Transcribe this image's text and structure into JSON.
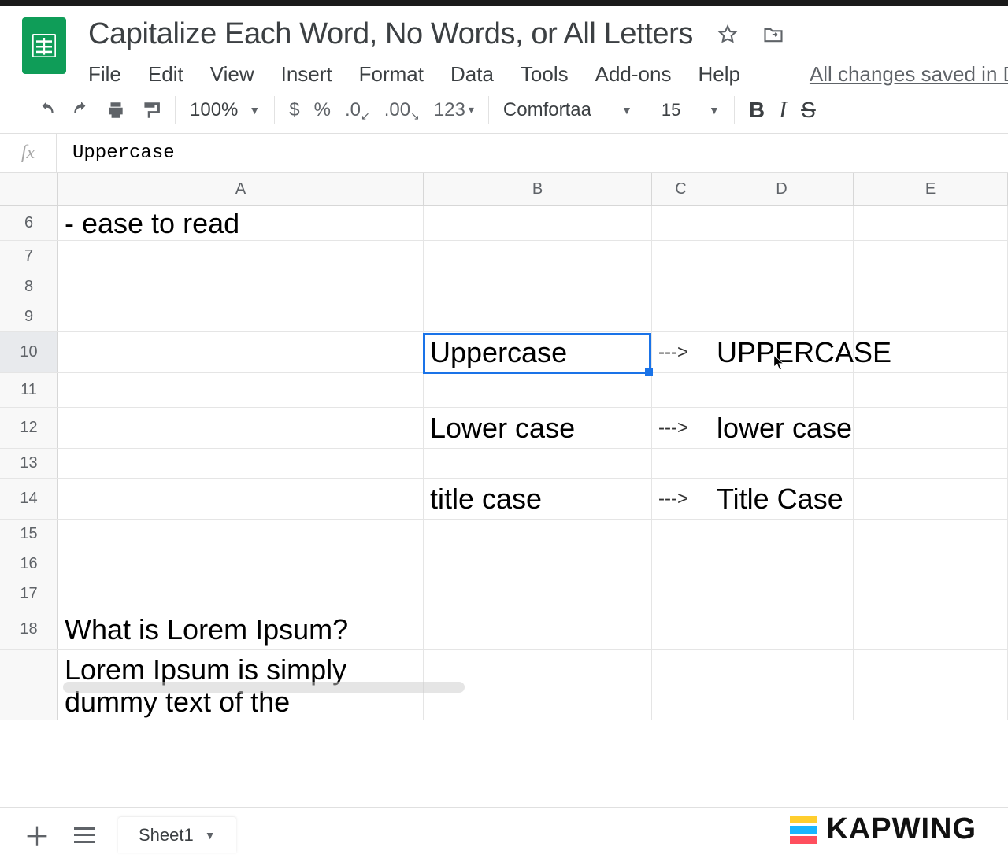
{
  "document_title": "Capitalize Each Word, No Words, or All Letters",
  "menu": {
    "file": "File",
    "edit": "Edit",
    "view": "View",
    "insert": "Insert",
    "format": "Format",
    "data": "Data",
    "tools": "Tools",
    "addons": "Add-ons",
    "help": "Help"
  },
  "save_status": "All changes saved in Dr",
  "toolbar": {
    "zoom": "100%",
    "currency": "$",
    "percent": "%",
    "dec_dec": ".0",
    "inc_dec": ".00",
    "numformat": "123",
    "font_name": "Comfortaa",
    "font_size": "15",
    "bold": "B",
    "italic": "I",
    "strike": "S"
  },
  "formula_bar": {
    "label": "fx",
    "value": "Uppercase"
  },
  "columns": {
    "A": "A",
    "B": "B",
    "C": "C",
    "D": "D",
    "E": "E"
  },
  "row_headers": [
    "6",
    "7",
    "8",
    "9",
    "10",
    "11",
    "12",
    "13",
    "14",
    "15",
    "16",
    "17",
    "18",
    ""
  ],
  "cells": {
    "A6": "- ease to read",
    "B10": "Uppercase",
    "C10": "--->",
    "D10": "UPPERCASE",
    "B12": "Lower case",
    "C12": "--->",
    "D12": "lower case",
    "B14": "title case",
    "C14": "--->",
    "D14": "Title Case",
    "A18": "What is Lorem Ipsum?",
    "A19a": "Lorem Ipsum is simply",
    "A19b": "dummy text of the"
  },
  "selection": {
    "cell": "B10"
  },
  "sheet_tab": "Sheet1",
  "watermark": "KAPWING"
}
